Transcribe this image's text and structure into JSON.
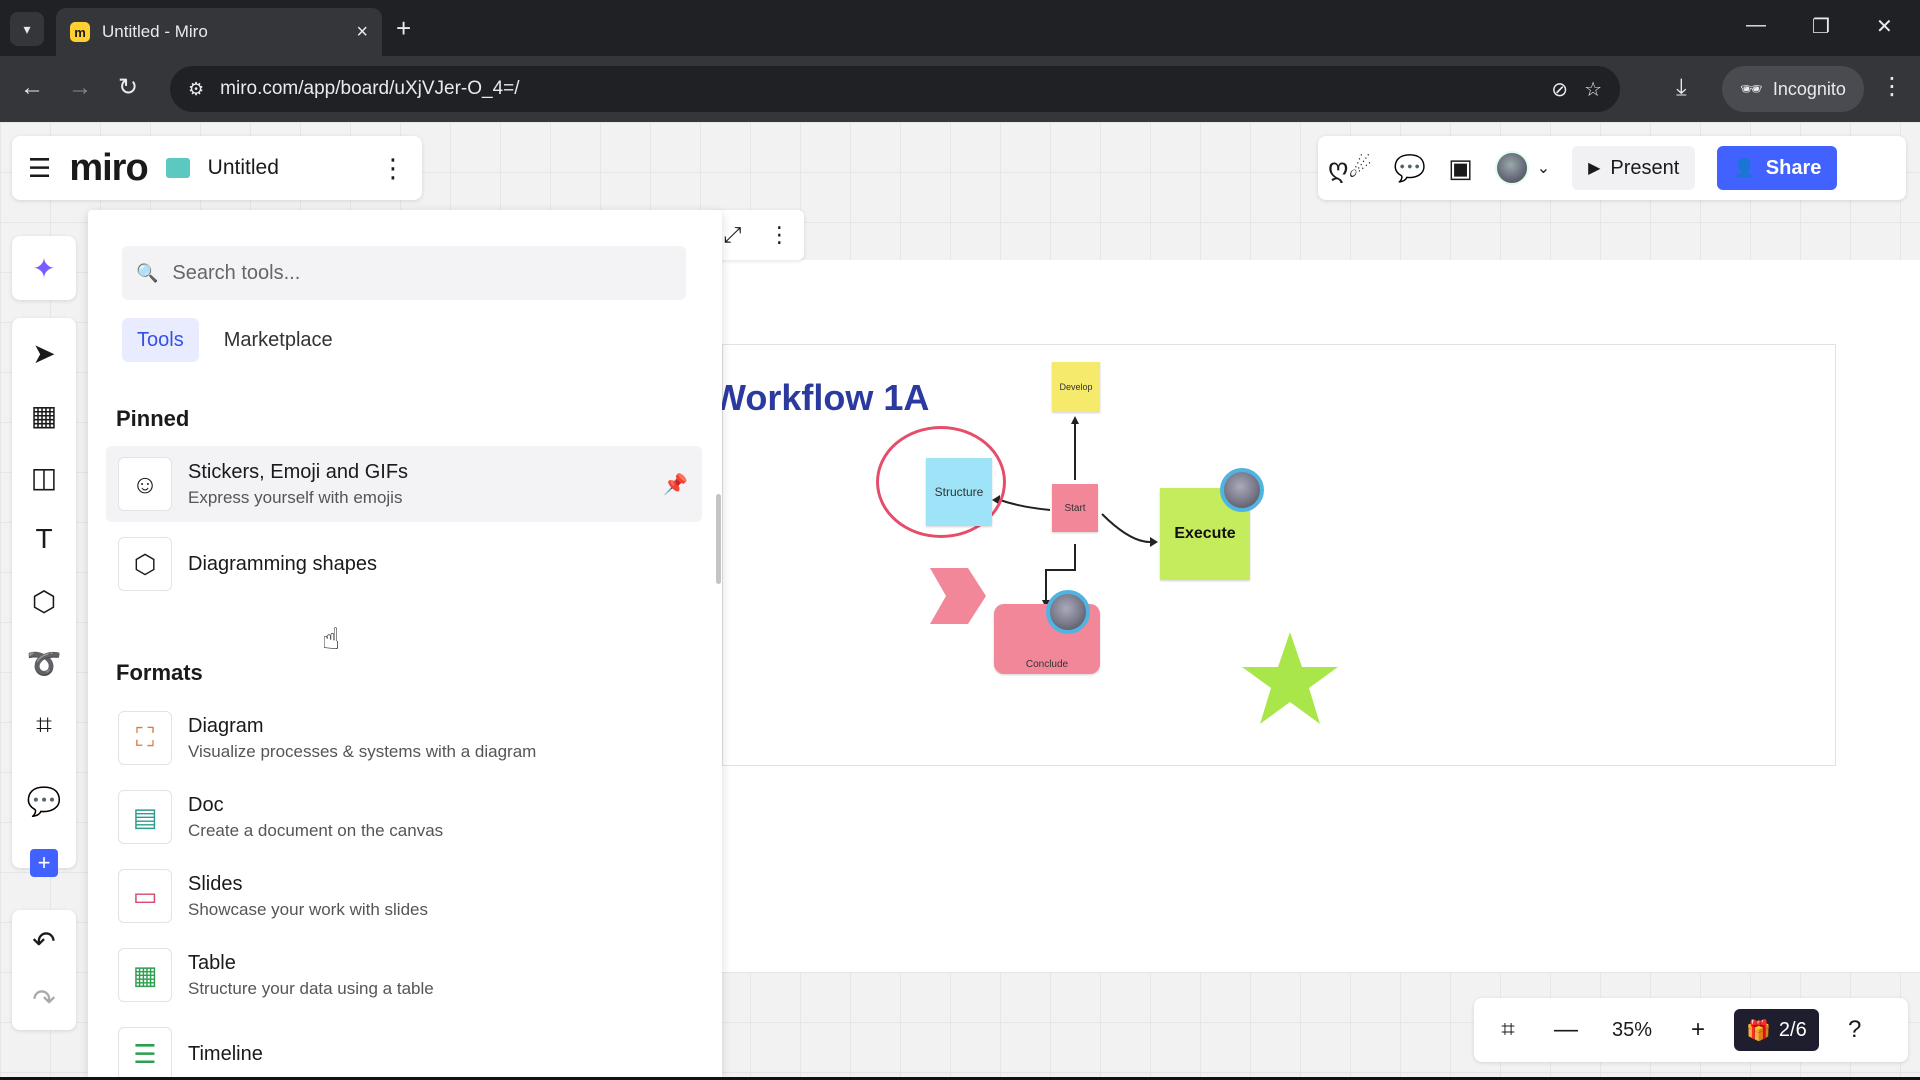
{
  "browser": {
    "tab_title": "Untitled - Miro",
    "url": "miro.com/app/board/uXjVJer-O_4=/",
    "incognito_label": "Incognito",
    "icons": {
      "tab_search": "chevron-down-icon",
      "close": "close-icon",
      "new_tab": "plus-icon",
      "back": "arrow-left-icon",
      "forward": "arrow-right-icon",
      "reload": "reload-icon"
    }
  },
  "app": {
    "logo": "miro",
    "board_name": "Untitled"
  },
  "header_right": {
    "present_label": "Present",
    "share_label": "Share",
    "accent": "#4262ff"
  },
  "tools_panel": {
    "search_placeholder": "Search tools...",
    "tabs": [
      {
        "label": "Tools",
        "active": true
      },
      {
        "label": "Marketplace",
        "active": false
      }
    ],
    "pinned_title": "Pinned",
    "pinned": [
      {
        "title": "Stickers, Emoji and GIFs",
        "desc": "Express yourself with emojis",
        "icon": "sticker-icon"
      },
      {
        "title": "Diagramming shapes",
        "desc": "",
        "icon": "shapes-icon"
      }
    ],
    "formats_title": "Formats",
    "formats": [
      {
        "title": "Diagram",
        "desc": "Visualize processes & systems with a diagram",
        "icon": "diagram-icon",
        "color": "#e0793e"
      },
      {
        "title": "Doc",
        "desc": "Create a document on the canvas",
        "icon": "doc-icon",
        "color": "#2a9d8f"
      },
      {
        "title": "Slides",
        "desc": "Showcase your work with slides",
        "icon": "slides-icon",
        "color": "#d64a6b"
      },
      {
        "title": "Table",
        "desc": "Structure your data using a table",
        "icon": "table-icon",
        "color": "#2e9e4f"
      },
      {
        "title": "Timeline",
        "desc": "",
        "icon": "timeline-icon",
        "color": "#2e9e4f"
      }
    ]
  },
  "board": {
    "title": "Workflow 1A",
    "stickies": {
      "develop": "Develop",
      "structure": "Structure",
      "start": "Start",
      "execute": "Execute",
      "conclude": "Conclude"
    },
    "colors": {
      "yellow": "#f5ea6b",
      "cyan": "#9ee3f7",
      "pink": "#f2879a",
      "green": "#c4ec5c",
      "star": "#a8e64a"
    }
  },
  "bottom_bar": {
    "zoom": "35%",
    "pages": "2/6"
  }
}
